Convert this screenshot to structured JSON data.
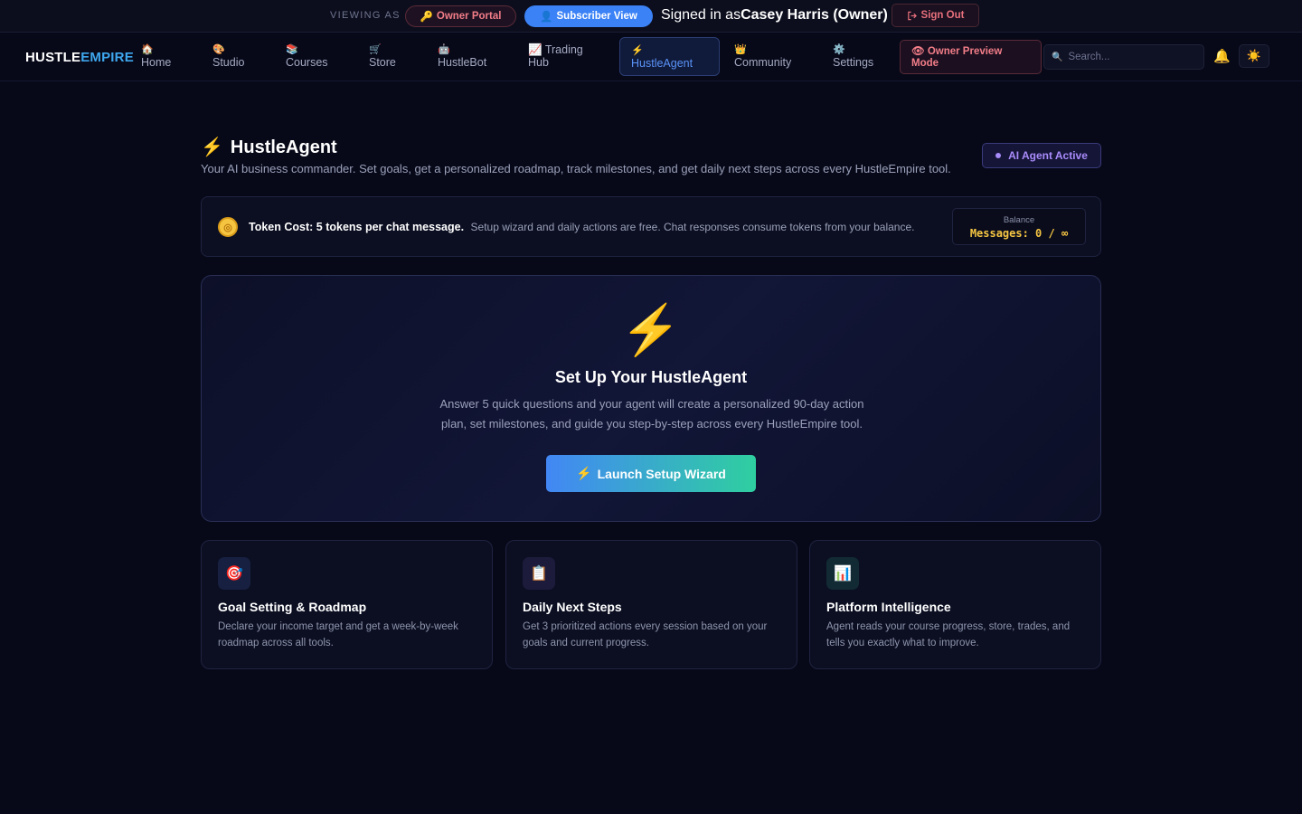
{
  "viewbar": {
    "viewing_as": "VIEWING AS",
    "owner_portal": "Owner Portal",
    "subscriber_view": "Subscriber View",
    "signed_in_prefix": "Signed in as",
    "signed_in_user": "Casey Harris (Owner)",
    "sign_out": "Sign Out",
    "icons": {
      "owner_portal": "key-icon",
      "subscriber_view": "user-icon",
      "sign_out": "sign-out-icon"
    }
  },
  "nav": {
    "logo_part1": "HUSTLE",
    "logo_part2": "EMPIRE",
    "items": [
      {
        "icon": "🏠",
        "icon_name": "house-icon",
        "label": "Home"
      },
      {
        "icon": "🎨",
        "icon_name": "palette-icon",
        "label": "Studio"
      },
      {
        "icon": "📚",
        "icon_name": "books-icon",
        "label": "Courses"
      },
      {
        "icon": "🛒",
        "icon_name": "cart-icon",
        "label": "Store"
      },
      {
        "icon": "🤖",
        "icon_name": "robot-icon",
        "label": "HustleBot"
      },
      {
        "icon": "📈",
        "icon_name": "chart-up-icon",
        "label_line1": "Trading",
        "label_line2": "Hub"
      },
      {
        "icon": "⚡",
        "icon_name": "lightning-icon",
        "label": "HustleAgent",
        "active": true
      },
      {
        "icon": "👑",
        "icon_name": "crown-icon",
        "label": "Community"
      },
      {
        "icon": "⚙️",
        "icon_name": "gear-icon",
        "label": "Settings"
      }
    ],
    "owner_preview_line1": "Owner Preview",
    "owner_preview_line2": "Mode",
    "owner_preview_icon": "👁",
    "search_placeholder": "Search...",
    "search_icon": "🔍",
    "bell_icon": "🔔",
    "theme_icon": "☀️"
  },
  "page": {
    "title_icon": "⚡",
    "title": "HustleAgent",
    "description": "Your AI business commander. Set goals, get a personalized roadmap, track milestones, and get daily next steps across every HustleEmpire tool.",
    "badge": "AI Agent Active"
  },
  "token": {
    "cost_label": "Token Cost: 5 tokens per chat message.",
    "cost_note": "Setup wizard and daily actions are free. Chat responses consume tokens from your balance.",
    "balance_label": "Balance",
    "balance_value": "Messages: 0 / ∞"
  },
  "setup": {
    "icon": "⚡",
    "title": "Set Up Your HustleAgent",
    "description": "Answer 5 quick questions and your agent will create a personalized 90-day action plan, set milestones, and guide you step-by-step across every HustleEmpire tool.",
    "button_icon": "⚡",
    "button": "Launch Setup Wizard"
  },
  "features": [
    {
      "icon": "🎯",
      "icon_name": "target-icon",
      "title": "Goal Setting & Roadmap",
      "description": "Declare your income target and get a week-by-week roadmap across all tools."
    },
    {
      "icon": "📋",
      "icon_name": "clipboard-icon",
      "title": "Daily Next Steps",
      "description": "Get 3 prioritized actions every session based on your goals and current progress."
    },
    {
      "icon": "📊",
      "icon_name": "bar-chart-icon",
      "title": "Platform Intelligence",
      "description": "Agent reads your course progress, store, trades, and tells you exactly what to improve."
    }
  ],
  "colors": {
    "background": "#070919",
    "accent_blue": "#3b82f6",
    "accent_gold": "#f5c542",
    "owner_red": "#f27d88",
    "agent_purple": "#a88bfa",
    "wizard_gradient_start": "#4287f5",
    "wizard_gradient_end": "#2fcfa0"
  }
}
